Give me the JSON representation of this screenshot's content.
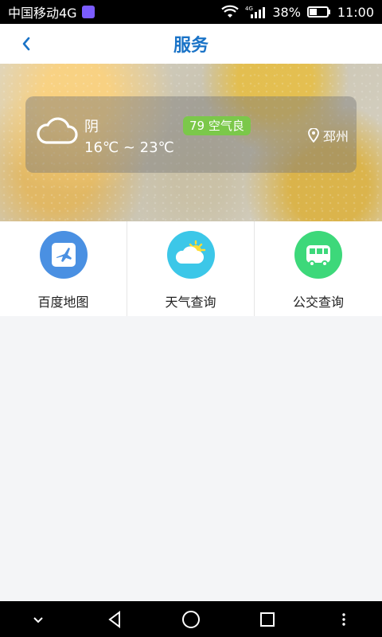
{
  "status": {
    "carrier": "中国移动4G",
    "network": "4G",
    "battery": "38%",
    "time": "11:00"
  },
  "header": {
    "title": "服务",
    "back_icon": "chevron-left-icon"
  },
  "weather": {
    "condition": "阴",
    "temperature": "16℃ ~ 23℃",
    "air_quality": "79 空气良",
    "location": "邳州",
    "icon": "cloud-icon"
  },
  "services": [
    {
      "label": "百度地图",
      "icon": "airplane-icon",
      "color": "#4a90e2"
    },
    {
      "label": "天气查询",
      "icon": "weather-icon",
      "color": "#3cc7e8"
    },
    {
      "label": "公交查询",
      "icon": "bus-icon",
      "color": "#3dd87a"
    }
  ],
  "navigation": {
    "icons": [
      "down-chevron-icon",
      "back-triangle-icon",
      "home-circle-icon",
      "recent-square-icon",
      "menu-dots-icon"
    ]
  }
}
